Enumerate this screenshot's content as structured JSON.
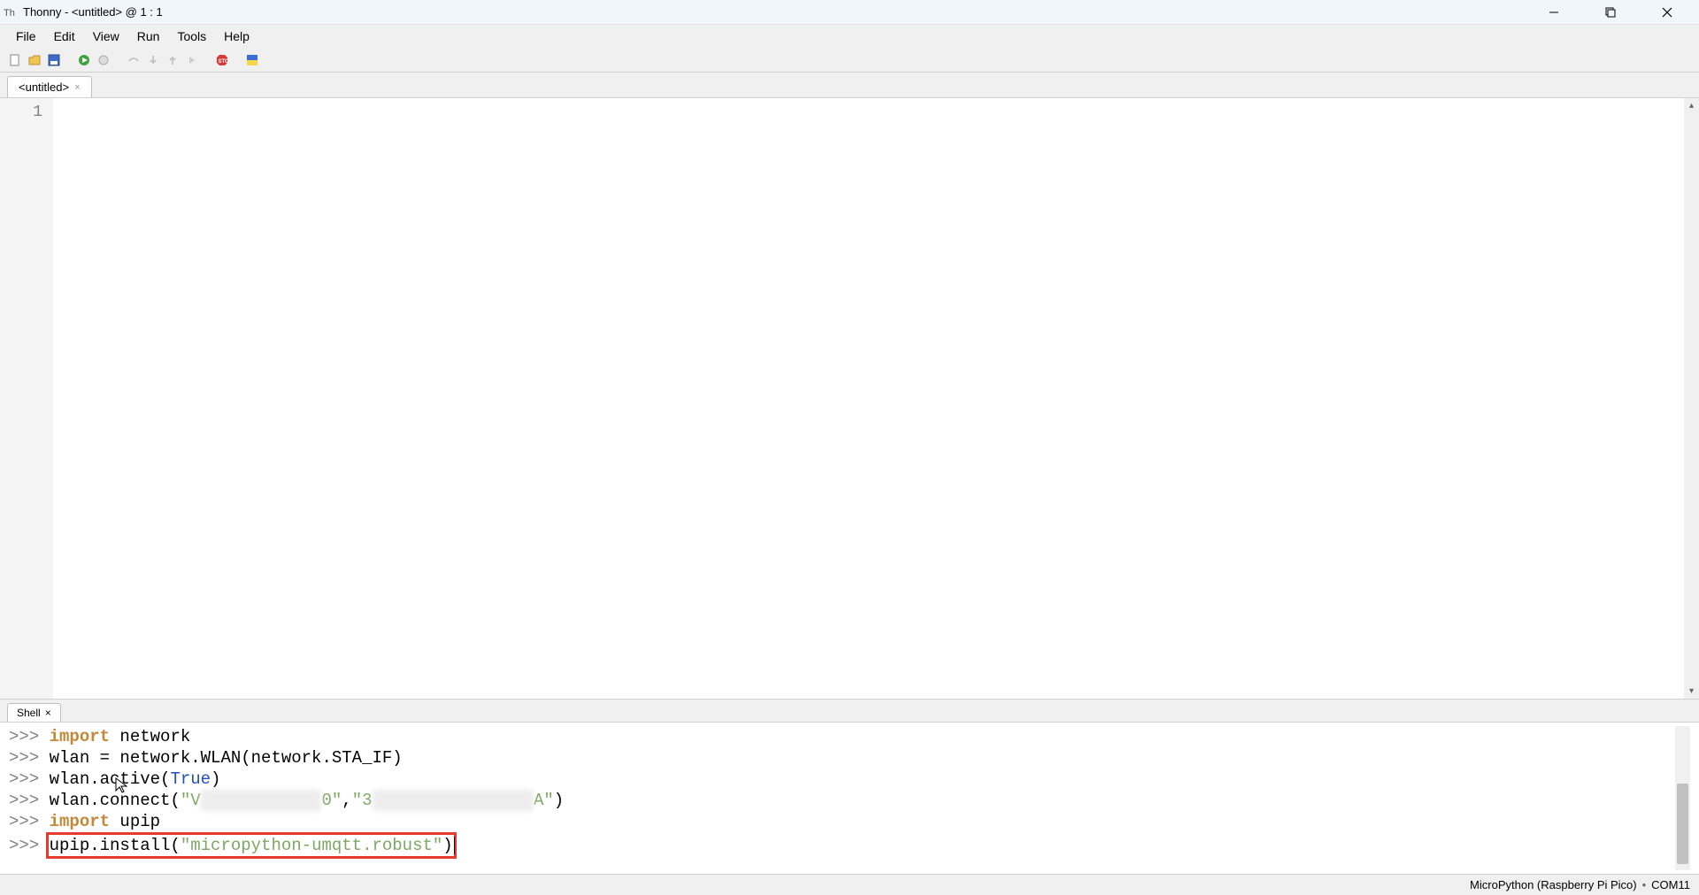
{
  "title_bar": {
    "app_name": "Thonny",
    "document": "<untitled>",
    "position": "@  1 : 1",
    "full": "Thonny  -  <untitled>  @  1 : 1"
  },
  "menu": {
    "file": "File",
    "edit": "Edit",
    "view": "View",
    "run": "Run",
    "tools": "Tools",
    "help": "Help"
  },
  "toolbar_icons": {
    "new": "new-file-icon",
    "open": "open-file-icon",
    "save": "save-icon",
    "run": "run-icon",
    "debug": "debug-icon",
    "step_over": "step-over-icon",
    "step_into": "step-into-icon",
    "step_out": "step-out-icon",
    "resume": "resume-icon",
    "stop": "stop-icon",
    "flag": "flag-icon"
  },
  "editor": {
    "tab_label": "<untitled>",
    "line_numbers": [
      "1"
    ],
    "content": ""
  },
  "shell": {
    "tab_label": "Shell",
    "prompt": ">>> ",
    "lines": [
      {
        "type": "code",
        "segments": [
          {
            "t": "kw",
            "v": "import"
          },
          {
            "t": "txt",
            "v": " network"
          }
        ]
      },
      {
        "type": "code",
        "segments": [
          {
            "t": "txt",
            "v": "wlan = network.WLAN(network.STA_IF)"
          }
        ]
      },
      {
        "type": "code",
        "segments": [
          {
            "t": "txt",
            "v": "wlan.active("
          },
          {
            "t": "const",
            "v": "True"
          },
          {
            "t": "txt",
            "v": ")"
          }
        ]
      },
      {
        "type": "code",
        "segments": [
          {
            "t": "txt",
            "v": "wlan.connect("
          },
          {
            "t": "str",
            "v": "\"V"
          },
          {
            "t": "blur",
            "v": "xxxxxxxxxxxx"
          },
          {
            "t": "str",
            "v": "0\""
          },
          {
            "t": "txt",
            "v": ","
          },
          {
            "t": "str",
            "v": "\"3"
          },
          {
            "t": "blur",
            "v": "xxxxxxxxxxxxxxxx"
          },
          {
            "t": "str",
            "v": "A\""
          },
          {
            "t": "txt",
            "v": ")"
          }
        ]
      },
      {
        "type": "code",
        "segments": [
          {
            "t": "kw",
            "v": "import"
          },
          {
            "t": "txt",
            "v": " upip"
          }
        ]
      },
      {
        "type": "highlight",
        "segments": [
          {
            "t": "txt",
            "v": "upip.install("
          },
          {
            "t": "str",
            "v": "\"micropython-umqtt.robust\""
          },
          {
            "t": "txt",
            "v": ")"
          }
        ]
      }
    ]
  },
  "status": {
    "interpreter": "MicroPython (Raspberry Pi Pico)",
    "port": "COM11"
  }
}
